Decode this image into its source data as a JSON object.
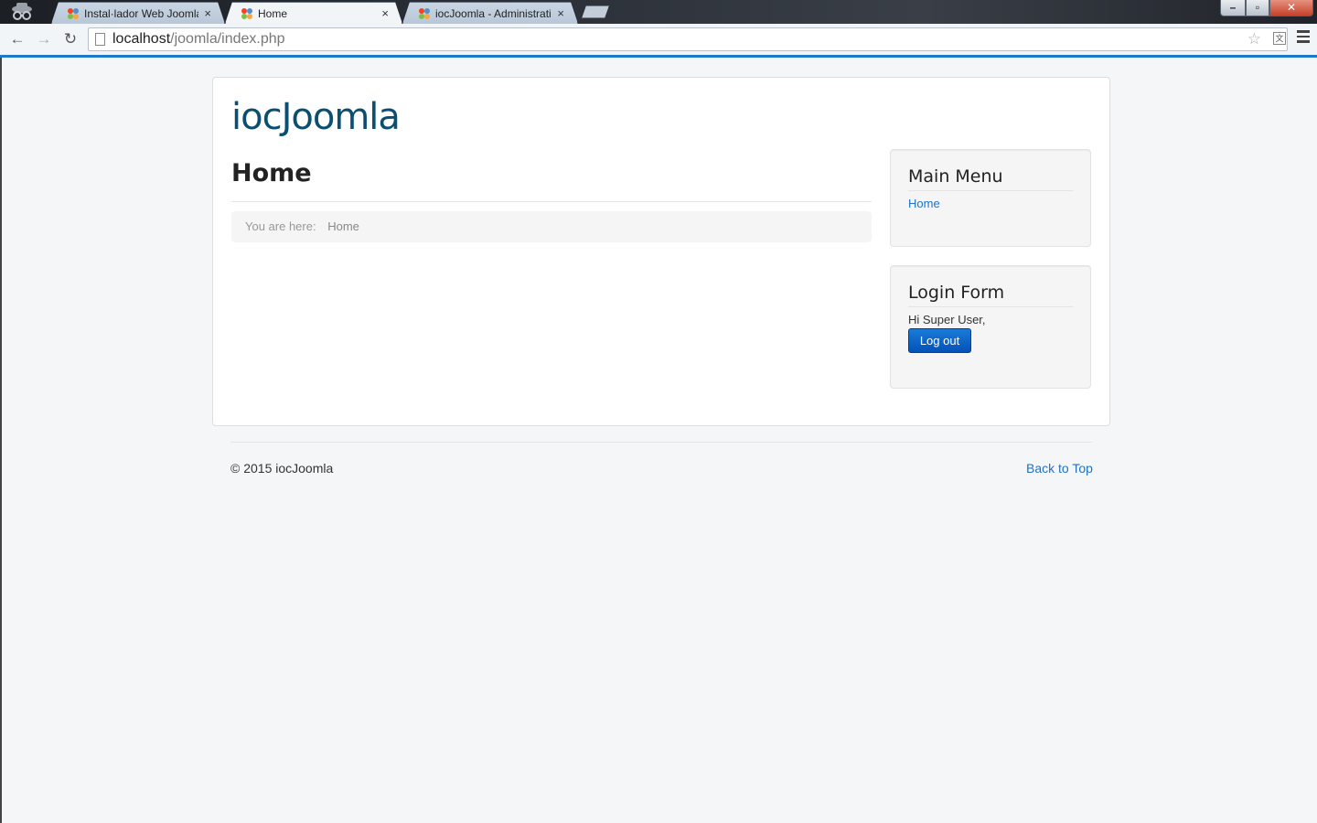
{
  "browser": {
    "tabs": [
      {
        "title": "Instal·lador Web Joomla!",
        "close": "×"
      },
      {
        "title": "Home",
        "close": "×",
        "active": true
      },
      {
        "title": "iocJoomla - Administratio",
        "close": "×"
      }
    ],
    "window_controls": {
      "minimize": "–",
      "maximize": "▫",
      "close": "✕"
    },
    "nav": {
      "back": "←",
      "forward": "→",
      "reload": "↻"
    },
    "address": {
      "host": "localhost",
      "path": "/joomla/index.php"
    },
    "star_icon": "☆",
    "translate_icon": "文",
    "accent_color": "#1e7ac8"
  },
  "site": {
    "brand": "iocJoomla",
    "page_title": "Home",
    "breadcrumb": {
      "prefix": "You are here:",
      "current": "Home"
    },
    "modules": {
      "main_menu": {
        "title": "Main Menu",
        "items": [
          "Home"
        ]
      },
      "login_form": {
        "title": "Login Form",
        "greeting": "Hi Super User,",
        "logout_label": "Log out"
      }
    },
    "footer": {
      "copyright": "© 2015 iocJoomla",
      "back_to_top": "Back to Top"
    },
    "colors": {
      "brand": "#0a4f71",
      "link": "#1f72c6",
      "button": "#0452b8"
    }
  }
}
